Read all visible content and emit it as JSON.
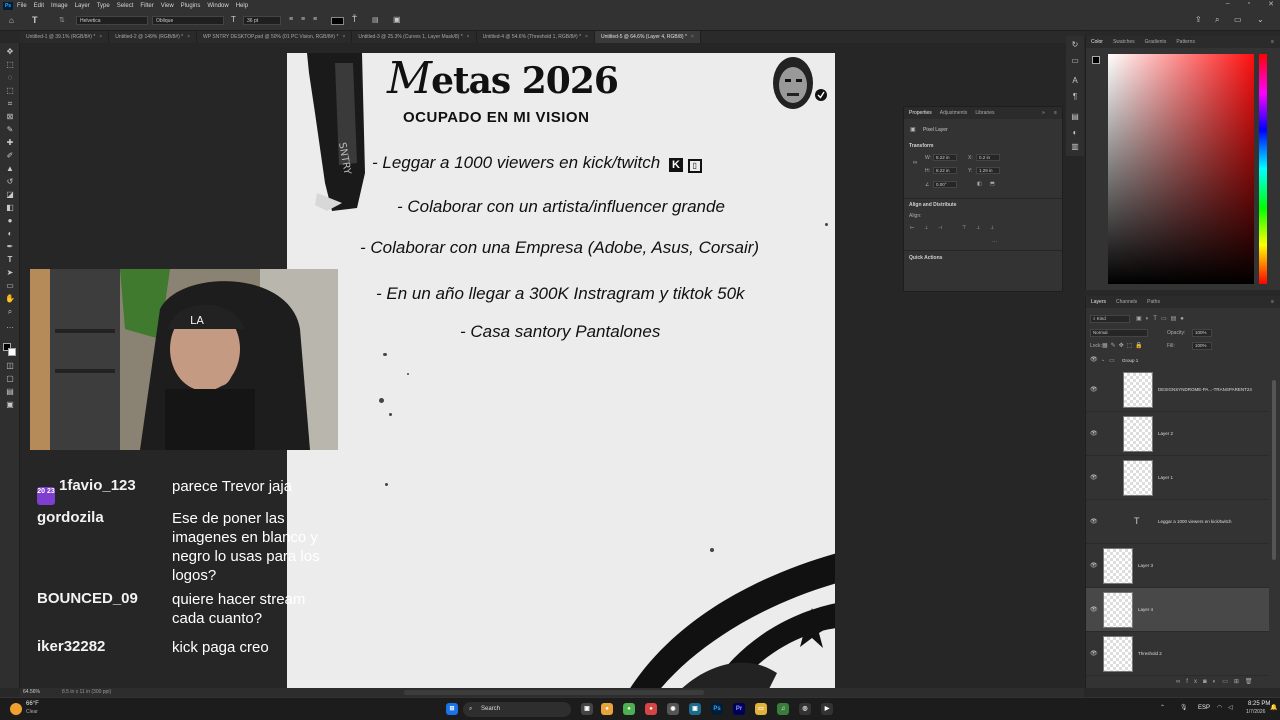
{
  "menubar": {
    "items": [
      "File",
      "Edit",
      "Image",
      "Layer",
      "Type",
      "Select",
      "Filter",
      "View",
      "Plugins",
      "Window",
      "Help"
    ]
  },
  "options": {
    "font": "Helvetica",
    "style": "Oblique",
    "size": "36 pt"
  },
  "tabs": [
    {
      "label": "Untitled-1 @ 39.1% (RGB/8#) *"
    },
    {
      "label": "Untitled-2 @ 149% (RGB/8#) *"
    },
    {
      "label": "WP SNTRY DESKTOP.psd @ 50% (01 PC Vision, RGB/8#) *"
    },
    {
      "label": "Untitled-3 @ 25.3% (Curves 1, Layer Mask/8) *"
    },
    {
      "label": "Untitled-4 @ 54.6% (Threshold 1, RGB/8#) *"
    },
    {
      "label": "Untitled-5 @ 64.6% (Layer 4, RGB/8) *"
    }
  ],
  "document": {
    "title_script": "M",
    "title_rest": "etas",
    "title_year": "2026",
    "subtitle": "OCUPADO EN MI VISION",
    "goals": [
      "- Leggar a 1000 viewers en kick/twitch",
      "- Colaborar con un artista/influencer grande",
      "- Colaborar con una Empresa (Adobe, Asus, Corsair)",
      "- En un año llegar a 300K Instragram y tiktok 50k",
      "- Casa santory Pantalones"
    ]
  },
  "chat": [
    {
      "user": "1favio_123",
      "badge": "20 23",
      "message": "parece Trevor jaja"
    },
    {
      "user": "gordozila",
      "message": "Ese de poner las imagenes en blanco y negro lo usas para los logos?"
    },
    {
      "user": "BOUNCED_09",
      "message": "quiere hacer stream cada cuanto?"
    },
    {
      "user": "iker32282",
      "message": "kick paga creo"
    }
  ],
  "properties": {
    "tabs": [
      "Properties",
      "Adjustments",
      "Libraries"
    ],
    "kind": "Pixel Layer",
    "transform_label": "Transform",
    "w": "8.22 in",
    "x": "0.2 in",
    "h": "8.22 in",
    "y": "1.29 in",
    "angle": "0.00°",
    "align_label": "Align and Distribute",
    "align_sub": "Align:",
    "quick_actions": "Quick Actions"
  },
  "color_panel": {
    "tabs": [
      "Color",
      "Swatches",
      "Gradients",
      "Patterns"
    ],
    "accent": "#ff1010"
  },
  "layers_panel": {
    "tabs": [
      "Layers",
      "Channels",
      "Paths"
    ],
    "kind": "Kind",
    "blend": "Normal",
    "opacity_label": "Opacity:",
    "opacity": "100%",
    "lock_label": "Lock:",
    "fill_label": "Fill:",
    "fill": "100%",
    "group": "Group 1",
    "layers": [
      {
        "name": "DESIGNSYNDROME-PA...-TRANSPARENT24"
      },
      {
        "name": "Layer 2"
      },
      {
        "name": "Layer 1"
      },
      {
        "name": "Leggar a 1000 viewers en kick/twitch",
        "text": true
      },
      {
        "name": "Layer 3"
      },
      {
        "name": "Layer 4",
        "selected": true
      },
      {
        "name": "Threshold 2"
      }
    ]
  },
  "status": {
    "zoom": "64.56%",
    "doc_size": "8.5 in x 11 in (300 ppi)"
  },
  "taskbar": {
    "temp": "66°F",
    "weather": "Clear",
    "search": "Search",
    "lang": "ESP",
    "time": "8:25 PM",
    "date": "1/7/2026"
  }
}
